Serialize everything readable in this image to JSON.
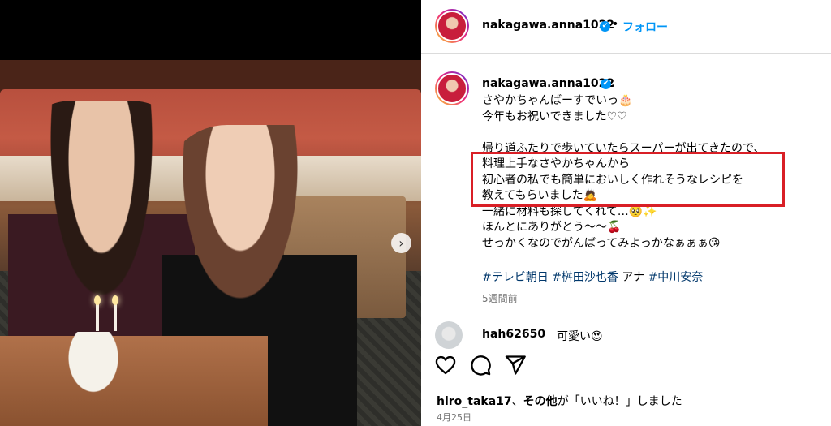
{
  "header": {
    "username": "nakagawa.anna1022",
    "verified_glyph": "✔",
    "separator": "•",
    "follow_label": "フォロー"
  },
  "caption": {
    "username": "nakagawa.anna1022",
    "verified_glyph": "✔",
    "trailing": ".",
    "text": "さやかちゃんばーすでいっ🎂\n今年もお祝いできました♡♡\n\n帰り道ふたりで歩いていたらスーパーが出てきたので、\n料理上手なさやかちゃんから\n初心者の私でも簡単においしく作れそうなレシピを\n教えてもらいました🙇\n一緒に材料も探してくれて…🥺✨\nほんとにありがとう〜〜🍒\nせっかくなのでがんばってみよっかなぁぁぁ😘",
    "hashtag_1": "#テレビ朝日",
    "hashtag_2": "#桝田沙也香",
    "plain_word": "アナ",
    "hashtag_3": "#中川安奈",
    "time_ago": "5週間前"
  },
  "comment": {
    "username": "hah62650",
    "text": "可愛い😍"
  },
  "likes": {
    "user": "hiro_taka17",
    "middle": "、",
    "others": "その他",
    "suffix": "が「いいね！」しました"
  },
  "date": "4月25日",
  "photo": {
    "next_glyph": "›"
  },
  "icons": [
    "heart-icon",
    "comment-icon",
    "share-icon",
    "verified-icon",
    "next-arrow-icon"
  ],
  "colors": {
    "accent": "#0095f6",
    "highlight_border": "#d91f26",
    "hashtag": "#00376b"
  }
}
